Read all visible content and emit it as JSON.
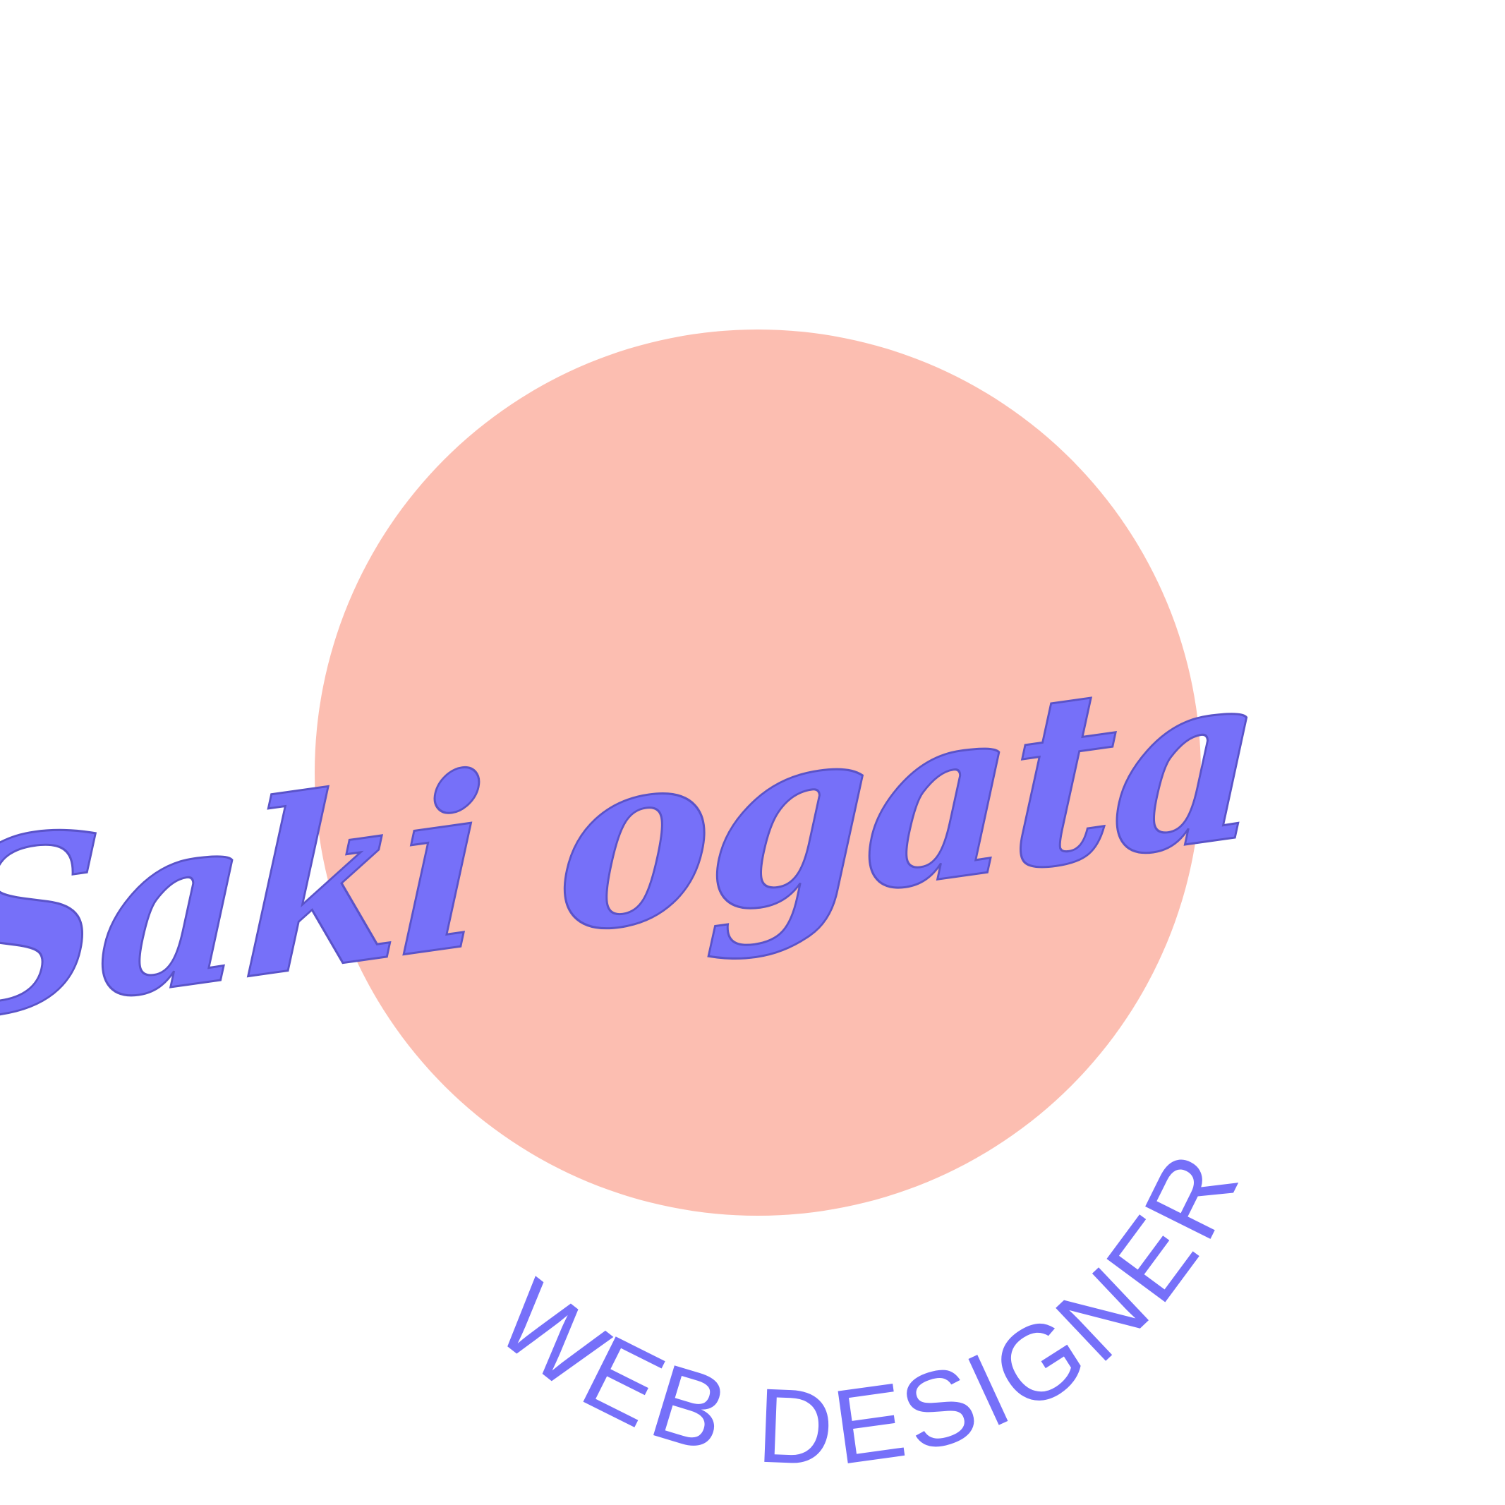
{
  "logo": {
    "name": "Saki ogata",
    "tagline": "WEB DESIGNER"
  },
  "colors": {
    "background": "#ffffff",
    "circle": "#fcbeb1",
    "text": "#7670f9",
    "outline": "#5a53c9"
  }
}
